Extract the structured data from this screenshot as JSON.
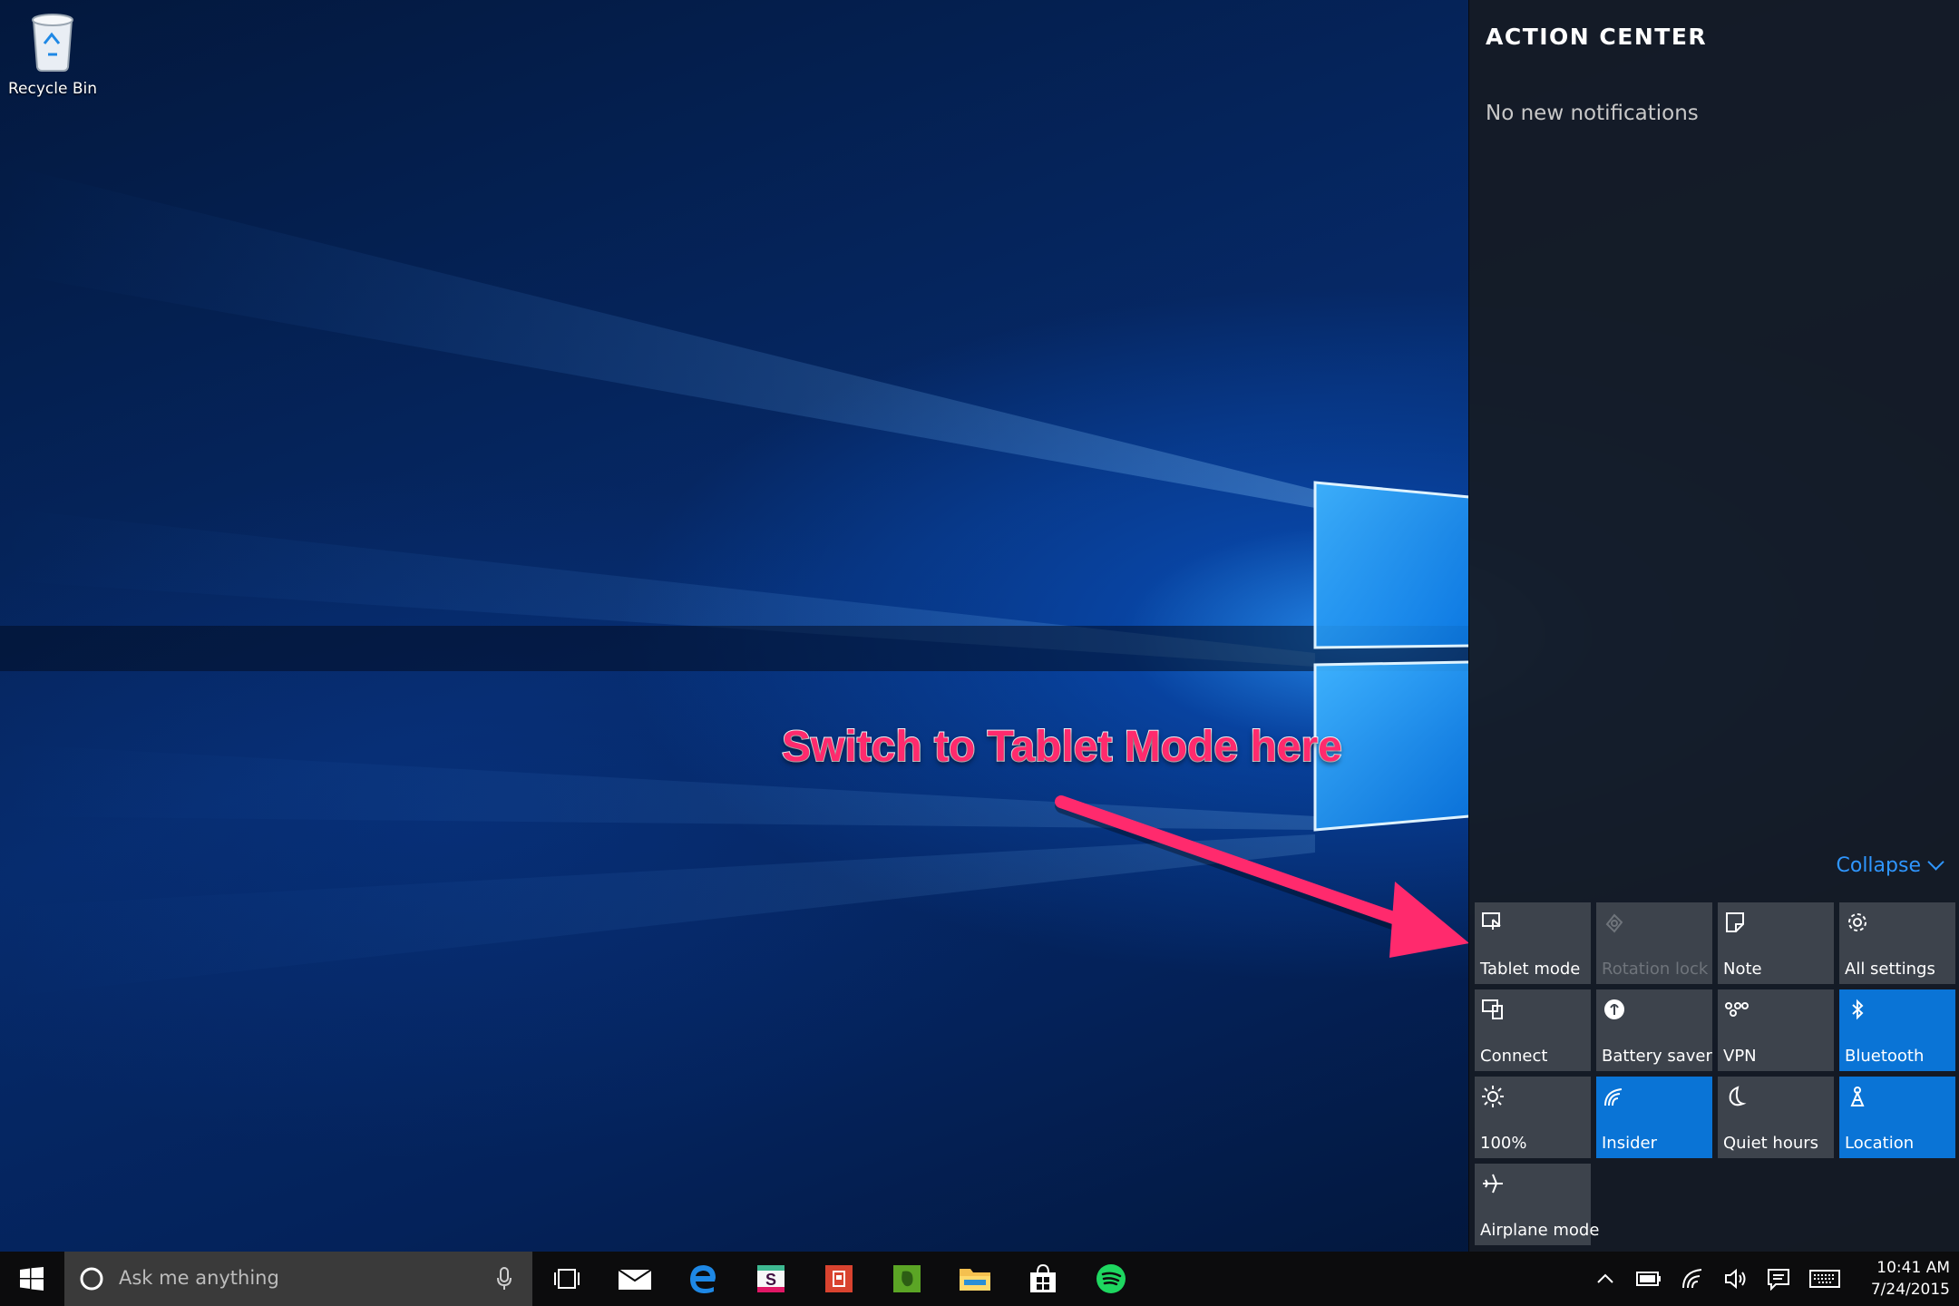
{
  "desktop": {
    "icons": [
      {
        "label": "Recycle Bin",
        "icon": "recycle-bin-icon"
      }
    ]
  },
  "annotation": {
    "text": "Switch to Tablet Mode here",
    "color": "#ff2a6d"
  },
  "action_center": {
    "title": "ACTION CENTER",
    "empty_message": "No new notifications",
    "collapse_label": "Collapse",
    "accent": "#2f96ff",
    "quick_actions": [
      {
        "label": "Tablet mode",
        "icon": "tablet-mode-icon",
        "state": "off"
      },
      {
        "label": "Rotation lock",
        "icon": "rotation-lock-icon",
        "state": "disabled"
      },
      {
        "label": "Note",
        "icon": "note-icon",
        "state": "off"
      },
      {
        "label": "All settings",
        "icon": "gear-icon",
        "state": "off"
      },
      {
        "label": "Connect",
        "icon": "connect-icon",
        "state": "off"
      },
      {
        "label": "Battery saver",
        "icon": "battery-saver-icon",
        "state": "off"
      },
      {
        "label": "VPN",
        "icon": "vpn-icon",
        "state": "off"
      },
      {
        "label": "Bluetooth",
        "icon": "bluetooth-icon",
        "state": "on"
      },
      {
        "label": "100%",
        "icon": "brightness-icon",
        "state": "off"
      },
      {
        "label": "Insider",
        "icon": "wifi-icon",
        "state": "on"
      },
      {
        "label": "Quiet hours",
        "icon": "moon-icon",
        "state": "off"
      },
      {
        "label": "Location",
        "icon": "location-icon",
        "state": "on"
      },
      {
        "label": "Airplane mode",
        "icon": "airplane-icon",
        "state": "off"
      }
    ]
  },
  "taskbar": {
    "search_placeholder": "Ask me anything",
    "pinned_apps": [
      {
        "name": "Task View",
        "icon": "task-view-icon"
      },
      {
        "name": "Mail",
        "icon": "mail-icon"
      },
      {
        "name": "Microsoft Edge",
        "icon": "edge-icon"
      },
      {
        "name": "Slack",
        "icon": "slack-icon"
      },
      {
        "name": "App",
        "icon": "red-app-icon"
      },
      {
        "name": "Evernote",
        "icon": "evernote-icon"
      },
      {
        "name": "File Explorer",
        "icon": "folder-icon"
      },
      {
        "name": "Store",
        "icon": "store-icon"
      },
      {
        "name": "Spotify",
        "icon": "spotify-icon"
      }
    ],
    "tray": [
      "chevron-up-icon",
      "battery-icon",
      "wifi-icon",
      "volume-icon",
      "notification-icon",
      "keyboard-icon"
    ],
    "time": "10:41 AM",
    "date": "7/24/2015"
  }
}
